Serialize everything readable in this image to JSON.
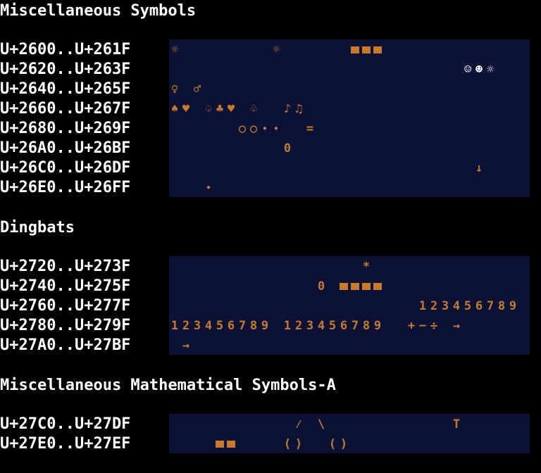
{
  "colors": {
    "background": "#000000",
    "grid_background": "#0c1236",
    "glyph": "#c87a2c",
    "glyph_alt": "#ffffff",
    "label": "#ffffff"
  },
  "sections": [
    {
      "title": "Miscellaneous Symbols",
      "rows": [
        {
          "label": "U+2600..U+261F",
          "cells": {
            "0": "☼",
            "9": "☼",
            "16": "",
            "17": "",
            "18": ""
          }
        },
        {
          "label": "U+2620..U+263F",
          "cells": {
            "26": "☺",
            "27": "☻",
            "28": "☼"
          }
        },
        {
          "label": "U+2640..U+265F",
          "cells": {
            "0": "♀",
            "2": "♂"
          }
        },
        {
          "label": "U+2660..U+267F",
          "cells": {
            "0": "♠",
            "1": "♥",
            "3": "♤",
            "4": "♣",
            "5": "♥",
            "7": "♧",
            "10": "♪",
            "11": "♫"
          }
        },
        {
          "label": "U+2680..U+269F",
          "cells": {
            "6": "○",
            "7": "○",
            "8": "•",
            "9": "•",
            "12": "="
          }
        },
        {
          "label": "U+26A0..U+26BF",
          "cells": {
            "10": "0"
          }
        },
        {
          "label": "U+26C0..U+26DF",
          "cells": {
            "27": "↓"
          }
        },
        {
          "label": "U+26E0..U+26FF",
          "cells": {
            "3": "•"
          }
        }
      ]
    },
    {
      "title": "Dingbats",
      "rows": [
        {
          "label": "U+2720..U+273F",
          "cells": {
            "17": "*"
          }
        },
        {
          "label": "U+2740..U+275F",
          "cells": {
            "13": "0",
            "15": "",
            "16": "",
            "17": "",
            "18": ""
          }
        },
        {
          "label": "U+2760..U+277F",
          "cells": {
            "22": "1",
            "23": "2",
            "24": "3",
            "25": "4",
            "26": "5",
            "27": "6",
            "28": "7",
            "29": "8",
            "30": "9"
          }
        },
        {
          "label": "U+2780..U+279F",
          "cells": {
            "0": "1",
            "1": "2",
            "2": "3",
            "3": "4",
            "4": "5",
            "5": "6",
            "6": "7",
            "7": "8",
            "8": "9",
            "10": "1",
            "11": "2",
            "12": "3",
            "13": "4",
            "14": "5",
            "15": "6",
            "16": "7",
            "17": "8",
            "18": "9",
            "21": "+",
            "22": "−",
            "23": "÷",
            "25": "→"
          }
        },
        {
          "label": "U+27A0..U+27BF",
          "cells": {
            "1": "→"
          }
        }
      ]
    },
    {
      "title": "Miscellaneous Mathematical Symbols-A",
      "rows": [
        {
          "label": "U+27C0..U+27DF",
          "cells": {
            "11": "⁄",
            "13": "\\",
            "25": "T"
          }
        },
        {
          "label": "U+27E0..U+27EF",
          "cells": {
            "4": "",
            "5": "",
            "10": "⟨",
            "11": "⟩",
            "14": "(",
            "15": ")"
          }
        }
      ]
    }
  ]
}
